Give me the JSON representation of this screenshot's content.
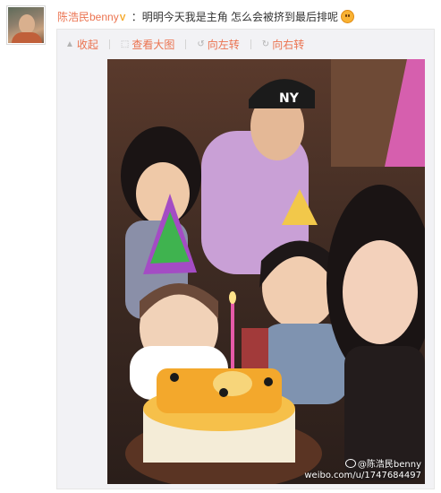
{
  "post": {
    "author": "陈浩民benny",
    "text": "：明明今天我是主角 怎么会被挤到最后排呢",
    "emoji": "smile-emoji"
  },
  "toolbar": {
    "collapse_label": "收起",
    "view_large_label": "查看大图",
    "rotate_left_label": "向左转",
    "rotate_right_label": "向右转"
  },
  "photo": {
    "watermark_name": "@陈浩民benny",
    "watermark_url": "weibo.com/u/1747684497"
  },
  "colors": {
    "accent": "#eb7350",
    "panel": "#f2f2f5"
  }
}
